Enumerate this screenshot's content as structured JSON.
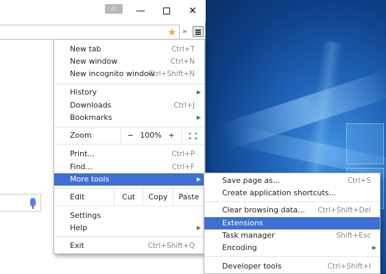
{
  "window": {
    "minimize_glyph": "—",
    "close_glyph": "✕",
    "overflow_glyph": "»"
  },
  "menu": {
    "new_tab": {
      "label": "New tab",
      "shortcut": "Ctrl+T"
    },
    "new_window": {
      "label": "New window",
      "shortcut": "Ctrl+N"
    },
    "new_incognito": {
      "label": "New incognito window",
      "shortcut": "Ctrl+Shift+N"
    },
    "history": {
      "label": "History"
    },
    "downloads": {
      "label": "Downloads",
      "shortcut": "Ctrl+J"
    },
    "bookmarks": {
      "label": "Bookmarks"
    },
    "zoom": {
      "label": "Zoom",
      "minus": "−",
      "value": "100%",
      "plus": "+"
    },
    "print": {
      "label": "Print...",
      "shortcut": "Ctrl+P"
    },
    "find": {
      "label": "Find...",
      "shortcut": "Ctrl+F"
    },
    "more_tools": {
      "label": "More tools"
    },
    "edit": {
      "label": "Edit",
      "cut": "Cut",
      "copy": "Copy",
      "paste": "Paste"
    },
    "settings": {
      "label": "Settings"
    },
    "help": {
      "label": "Help"
    },
    "exit": {
      "label": "Exit",
      "shortcut": "Ctrl+Shift+Q"
    }
  },
  "submenu": {
    "save_page": {
      "label": "Save page as...",
      "shortcut": "Ctrl+S"
    },
    "create_shortcuts": {
      "label": "Create application shortcuts..."
    },
    "clear_browsing": {
      "label": "Clear browsing data...",
      "shortcut": "Ctrl+Shift+Del"
    },
    "extensions": {
      "label": "Extensions"
    },
    "task_manager": {
      "label": "Task manager",
      "shortcut": "Shift+Esc"
    },
    "encoding": {
      "label": "Encoding"
    },
    "developer_tools": {
      "label": "Developer tools",
      "shortcut": "Ctrl+Shift+I"
    }
  },
  "colors": {
    "highlight": "#3d6fd6",
    "desktop": "#1f63b8"
  }
}
